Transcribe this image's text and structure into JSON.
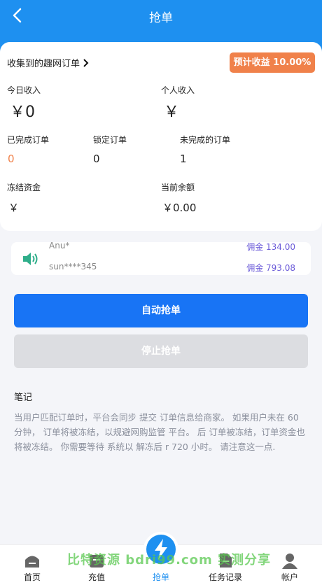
{
  "header": {
    "title": "抢单"
  },
  "collect": {
    "label": "收集到的趣网订单"
  },
  "badge": {
    "label": "预计收益 10.00%"
  },
  "stats": {
    "today_income_label": "今日收入",
    "today_income_value": "￥0",
    "personal_income_label": "个人收入",
    "personal_income_value": "￥",
    "completed_label": "已完成订单",
    "completed_value": "0",
    "locked_label": "锁定订单",
    "locked_value": "0",
    "unfinished_label": "未完成的订单",
    "unfinished_value": "1",
    "frozen_label": "冻结资金",
    "frozen_value": "￥",
    "balance_label": "当前余额",
    "balance_value": "￥0.00"
  },
  "notice": {
    "items": [
      {
        "user": "Anu*",
        "commission": "佣金 134.00"
      },
      {
        "user": "sun****345",
        "commission": "佣金 793.08"
      }
    ]
  },
  "buttons": {
    "auto": "自动抢单",
    "stop": "停止抢单"
  },
  "notes": {
    "title": "笔记",
    "body": "当用户匹配订单时，平台会同步 提交 订单信息给商家。 如果用户未在 60  分钟， 订单将被冻结，以规避网购监管 平台。 后 订单被冻结，订单资金也将被冻结。 你需要等待 系统以 解冻后 r 720 小时。 请注意这一点."
  },
  "tabbar": {
    "tabs": [
      {
        "label": "首页"
      },
      {
        "label": "充值"
      },
      {
        "label": "抢单"
      },
      {
        "label": "任务记录"
      },
      {
        "label": "帐户"
      }
    ]
  },
  "watermark": "比特资源 bdri99.com 实测分享",
  "colors": {
    "primary": "#1e90f0",
    "badge": "#f0814a",
    "button": "#1874f5",
    "accent_value": "#f0814a"
  }
}
